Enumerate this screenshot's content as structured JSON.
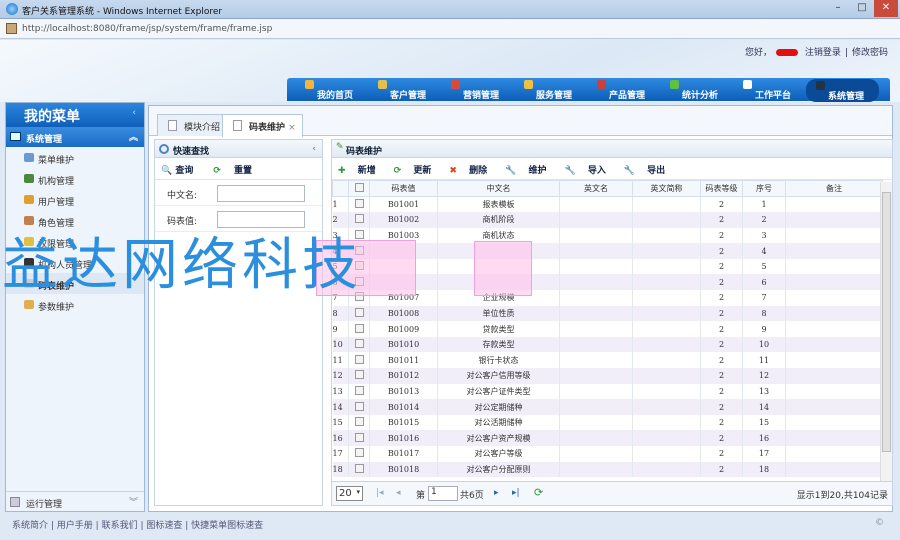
{
  "window": {
    "title": "客户关系管理系统 - Windows Internet Explorer",
    "url": "http://localhost:8080/frame/jsp/system/frame/frame.jsp"
  },
  "header": {
    "greeting": "您好，",
    "logout": "注销登录",
    "sep": "|",
    "change_password": "修改密码",
    "nav": [
      {
        "label": "我的首页",
        "color": "#f2b440"
      },
      {
        "label": "客户管理",
        "color": "#e2c050"
      },
      {
        "label": "营销管理",
        "color": "#d84a3a"
      },
      {
        "label": "服务管理",
        "color": "#f0c040"
      },
      {
        "label": "产品管理",
        "color": "#c84040"
      },
      {
        "label": "统计分析",
        "color": "#60c040"
      },
      {
        "label": "工作平台",
        "color": "#ffffff"
      },
      {
        "label": "系统管理",
        "color": "#223344"
      }
    ]
  },
  "sidebar": {
    "title": "我的菜单",
    "group": "系统管理",
    "items": [
      "菜单维护",
      "机构管理",
      "用户管理",
      "角色管理",
      "权限管理",
      "机构人员管理",
      "码表维护",
      "参数维护"
    ],
    "bottom_group": "运行管理"
  },
  "tabs": [
    "模块介绍",
    "码表维护"
  ],
  "search": {
    "title": "快速查找",
    "query": "查询",
    "reset": "重置",
    "fields": [
      {
        "label": "中文名:",
        "value": ""
      },
      {
        "label": "码表值:",
        "value": ""
      }
    ]
  },
  "grid": {
    "title": "码表维护",
    "toolbar": [
      "新增",
      "更新",
      "删除",
      "维护",
      "导入",
      "导出"
    ],
    "columns": [
      "",
      "",
      "码表值",
      "中文名",
      "英文名",
      "英文简称",
      "码表等级",
      "序号",
      "备注"
    ],
    "rows": [
      [
        "1",
        "B01001",
        "报表模板",
        "2",
        "1"
      ],
      [
        "2",
        "B01002",
        "商机阶段",
        "2",
        "2"
      ],
      [
        "3",
        "B01003",
        "商机状态",
        "2",
        "3"
      ],
      [
        "4",
        "",
        "",
        "2",
        "4"
      ],
      [
        "5",
        "",
        "",
        "2",
        "5"
      ],
      [
        "6",
        "",
        "",
        "2",
        "6"
      ],
      [
        "7",
        "B01007",
        "企业规模",
        "2",
        "7"
      ],
      [
        "8",
        "B01008",
        "单位性质",
        "2",
        "8"
      ],
      [
        "9",
        "B01009",
        "贷款类型",
        "2",
        "9"
      ],
      [
        "10",
        "B01010",
        "存款类型",
        "2",
        "10"
      ],
      [
        "11",
        "B01011",
        "银行卡状态",
        "2",
        "11"
      ],
      [
        "12",
        "B01012",
        "对公客户信用等级",
        "2",
        "12"
      ],
      [
        "13",
        "B01013",
        "对公客户证件类型",
        "2",
        "13"
      ],
      [
        "14",
        "B01014",
        "对公定期储种",
        "2",
        "14"
      ],
      [
        "15",
        "B01015",
        "对公活期储种",
        "2",
        "15"
      ],
      [
        "16",
        "B01016",
        "对公客户资产规模",
        "2",
        "16"
      ],
      [
        "17",
        "B01017",
        "对公客户等级",
        "2",
        "17"
      ],
      [
        "18",
        "B01018",
        "对公客户分配原则",
        "2",
        "18"
      ]
    ],
    "pager": {
      "page_size": "20",
      "page_prefix": "第",
      "page": "1",
      "total_pages": "共6页",
      "summary": "显示1到20,共104记录"
    }
  },
  "footer": {
    "links": [
      "系统简介",
      "用户手册",
      "联系我们",
      "图标速查",
      "快捷菜单图标速查"
    ],
    "copyright": "©"
  },
  "watermark": "益达网络科技"
}
